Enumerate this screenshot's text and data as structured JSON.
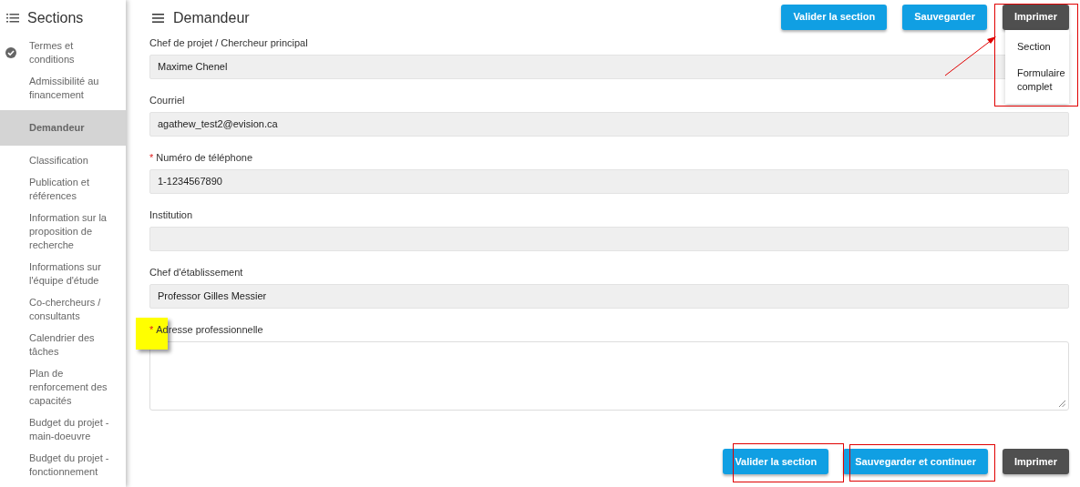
{
  "sidebar": {
    "title": "Sections",
    "items": [
      {
        "label": "Termes et conditions",
        "completed": true,
        "selected": false
      },
      {
        "label": "Admissibilité au financement",
        "completed": false,
        "selected": false
      },
      {
        "label": "Demandeur",
        "completed": false,
        "selected": true
      },
      {
        "label": "Classification",
        "completed": false,
        "selected": false
      },
      {
        "label": "Publication et références",
        "completed": false,
        "selected": false
      },
      {
        "label": "Information sur la proposition de recherche",
        "completed": false,
        "selected": false
      },
      {
        "label": "Informations sur l'équipe d'étude",
        "completed": false,
        "selected": false
      },
      {
        "label": "Co-chercheurs / consultants",
        "completed": false,
        "selected": false
      },
      {
        "label": "Calendrier des tâches",
        "completed": false,
        "selected": false
      },
      {
        "label": "Plan de renforcement des capacités",
        "completed": false,
        "selected": false
      },
      {
        "label": "Budget du projet - main-doeuvre",
        "completed": false,
        "selected": false
      },
      {
        "label": "Budget du projet - fonctionnement",
        "completed": false,
        "selected": false
      }
    ]
  },
  "header": {
    "title": "Demandeur"
  },
  "required_marker": "*",
  "top_buttons": [
    {
      "label": "Valider la section",
      "kind": "primary"
    },
    {
      "label": "Sauvegarder",
      "kind": "primary"
    },
    {
      "label": "Imprimer",
      "kind": "dark"
    }
  ],
  "print_menu": {
    "items": [
      "Section",
      "Formulaire complet"
    ]
  },
  "fields": [
    {
      "label": "Chef de projet / Chercheur principal",
      "required": false,
      "value": "Maxime Chenel",
      "kind": "input"
    },
    {
      "label": "Courriel",
      "required": false,
      "value": "agathew_test2@evision.ca",
      "kind": "input"
    },
    {
      "label": "Numéro de téléphone",
      "required": true,
      "value": "1-1234567890",
      "kind": "input"
    },
    {
      "label": "Institution",
      "required": false,
      "kind": "input"
    },
    {
      "label": "Chef d'établissement",
      "required": false,
      "value": "Professor Gilles Messier",
      "kind": "input"
    },
    {
      "label": "Adresse professionnelle",
      "required": true,
      "kind": "textarea"
    }
  ],
  "bottom_buttons": [
    {
      "label": "Valider la section",
      "kind": "primary"
    },
    {
      "label": "Sauvegarder et continuer",
      "kind": "primary"
    },
    {
      "label": "Imprimer",
      "kind": "dark"
    }
  ]
}
